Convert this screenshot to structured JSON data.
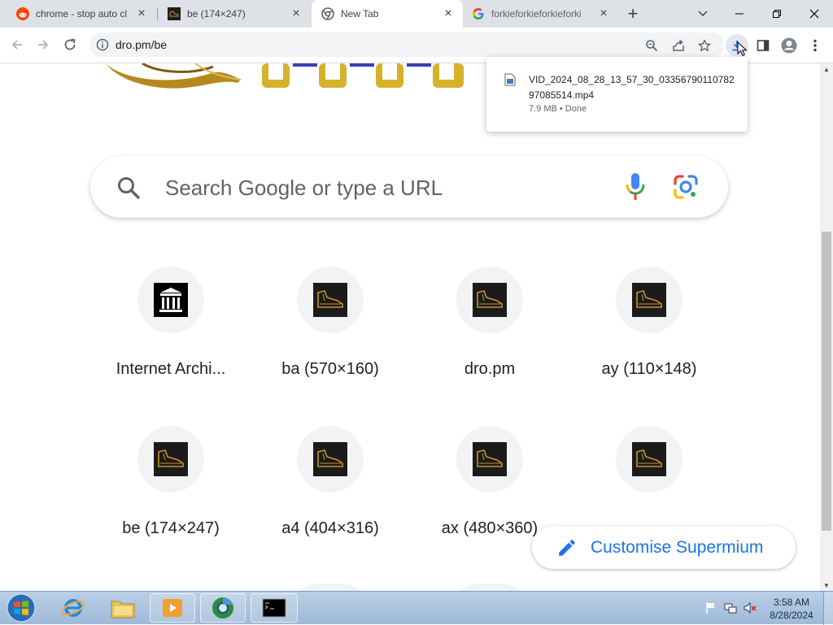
{
  "browser": {
    "tabs": [
      {
        "title": "chrome - stop auto cl",
        "favicon": "reddit-icon"
      },
      {
        "title": "be (174×247)",
        "favicon": "image-thumbnail-icon"
      },
      {
        "title": "New Tab",
        "favicon": "chrome-icon",
        "active": true
      },
      {
        "title": "forkieforkieforkieforki",
        "favicon": "google-icon"
      }
    ],
    "new_tab_symbol": "+",
    "url": "dro.pm/be"
  },
  "downloads": {
    "filename": "VID_2024_08_28_13_57_30_0335679011078297085514.mp4",
    "status": "7.9 MB • Done"
  },
  "ntp": {
    "search_placeholder": "Search Google or type a URL",
    "shortcuts": [
      {
        "label": "Internet Archi...",
        "icon": "internet-archive-icon"
      },
      {
        "label": "ba (570×160)",
        "icon": "boot-thumbnail-icon"
      },
      {
        "label": "dro.pm",
        "icon": "boot-thumbnail-icon"
      },
      {
        "label": "ay (110×148)",
        "icon": "boot-thumbnail-icon"
      },
      {
        "label": "be (174×247)",
        "icon": "boot-thumbnail-icon"
      },
      {
        "label": "a4 (404×316)",
        "icon": "boot-thumbnail-icon"
      },
      {
        "label": "ax (480×360)",
        "icon": "boot-thumbnail-icon"
      }
    ],
    "customise_label": "Customise Supermium"
  },
  "taskbar": {
    "time": "3:58 AM",
    "date": "8/28/2024"
  },
  "colors": {
    "accent": "#1a73e8",
    "tabstrip": "#dee1e6",
    "taskbar": "#a9c2df"
  }
}
